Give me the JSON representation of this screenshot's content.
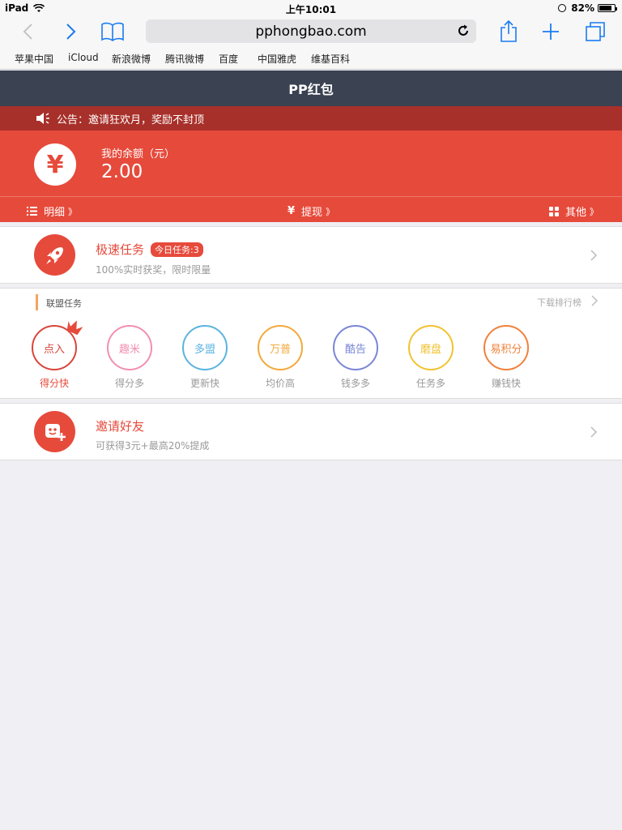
{
  "status": {
    "carrier": "iPad",
    "time": "上午10:01",
    "battery": "82%",
    "battery_level": 0.82
  },
  "browser": {
    "url": "pphongbao.com",
    "favorites": [
      "苹果中国",
      "iCloud",
      "新浪微博",
      "腾讯微博",
      "百度",
      "中国雅虎",
      "维基百科"
    ]
  },
  "page": {
    "title": "PP红包"
  },
  "notice": {
    "text": "公告：邀请狂欢月，奖励不封顶"
  },
  "balance": {
    "symbol": "¥",
    "label": "我的余额（元）",
    "value": "2.00",
    "actions": [
      {
        "label": "明细",
        "arrow": "》"
      },
      {
        "label": "提现",
        "arrow": "》"
      },
      {
        "label": "其他",
        "arrow": "》"
      }
    ]
  },
  "fast_task": {
    "title": "极速任务",
    "badge": "今日任务:3",
    "subtitle": "100%实时获奖，限时限量"
  },
  "alliance": {
    "title": "联盟任务",
    "rank_link": "下载排行榜",
    "partners": [
      {
        "name": "点入",
        "tag": "得分快",
        "color": "#d9453a"
      },
      {
        "name": "趣米",
        "tag": "得分多",
        "color": "#f28fb2"
      },
      {
        "name": "多盟",
        "tag": "更新快",
        "color": "#5ab4e0"
      },
      {
        "name": "万普",
        "tag": "均价高",
        "color": "#f2a93b"
      },
      {
        "name": "酷告",
        "tag": "钱多多",
        "color": "#7a86d6"
      },
      {
        "name": "磨盘",
        "tag": "任务多",
        "color": "#f2c230"
      },
      {
        "name": "易积分",
        "tag": "赚钱快",
        "color": "#f0813a"
      }
    ]
  },
  "invite": {
    "title": "邀请好友",
    "subtitle": "可获得3元+最高20%提成"
  },
  "colors": {
    "brand_red": "#e64a3b",
    "header_dark": "#3b4252",
    "notice_red": "#a8302a"
  }
}
